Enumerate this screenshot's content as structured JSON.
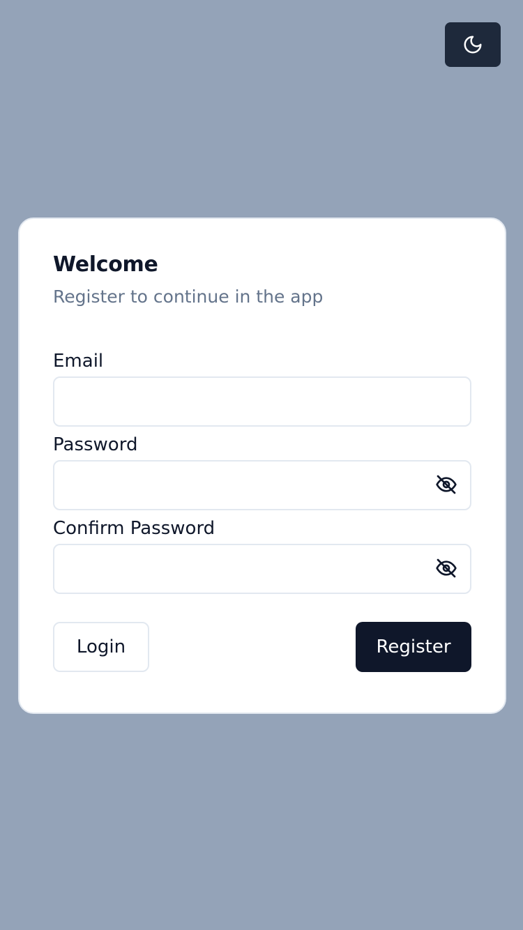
{
  "theme_toggle": {
    "icon": "moon-icon",
    "background": "#1e293b"
  },
  "card": {
    "title": "Welcome",
    "subtitle": "Register to continue in the app"
  },
  "form": {
    "email": {
      "label": "Email",
      "value": "",
      "placeholder": ""
    },
    "password": {
      "label": "Password",
      "value": "",
      "placeholder": "",
      "toggle_icon": "eye-off-icon"
    },
    "confirm_password": {
      "label": "Confirm Password",
      "value": "",
      "placeholder": "",
      "toggle_icon": "eye-off-icon"
    }
  },
  "actions": {
    "login_label": "Login",
    "register_label": "Register"
  },
  "colors": {
    "page_background": "#94a3b8",
    "card_background": "#ffffff",
    "primary": "#0f172a",
    "muted_text": "#64748b",
    "border": "#e2e8f0"
  }
}
